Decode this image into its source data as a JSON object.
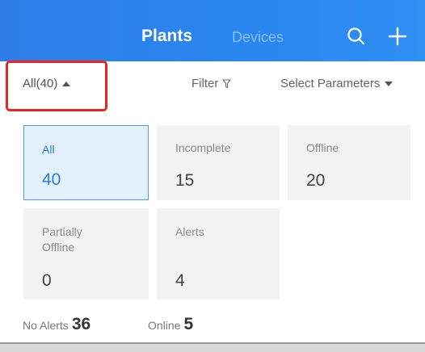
{
  "header": {
    "tabs": [
      {
        "label": "Plants",
        "active": true
      },
      {
        "label": "Devices",
        "active": false
      }
    ],
    "icons": [
      "search-icon",
      "add-icon"
    ],
    "accent": "#2a86f0"
  },
  "filterbar": {
    "all_label": "All(40)",
    "filter_label": "Filter",
    "params_label": "Select Parameters",
    "highlight_color": "#e8271f"
  },
  "cards": [
    {
      "label": "All",
      "value": "40",
      "selected": true
    },
    {
      "label": "Incomplete",
      "value": "15",
      "selected": false
    },
    {
      "label": "Offline",
      "value": "20",
      "selected": false
    },
    {
      "label": "Partially\nOffline",
      "value": "0",
      "selected": false
    },
    {
      "label": "Alerts",
      "value": "4",
      "selected": false
    }
  ],
  "summary": [
    {
      "label": "No Alerts",
      "value": "36"
    },
    {
      "label": "Online",
      "value": "5"
    }
  ]
}
